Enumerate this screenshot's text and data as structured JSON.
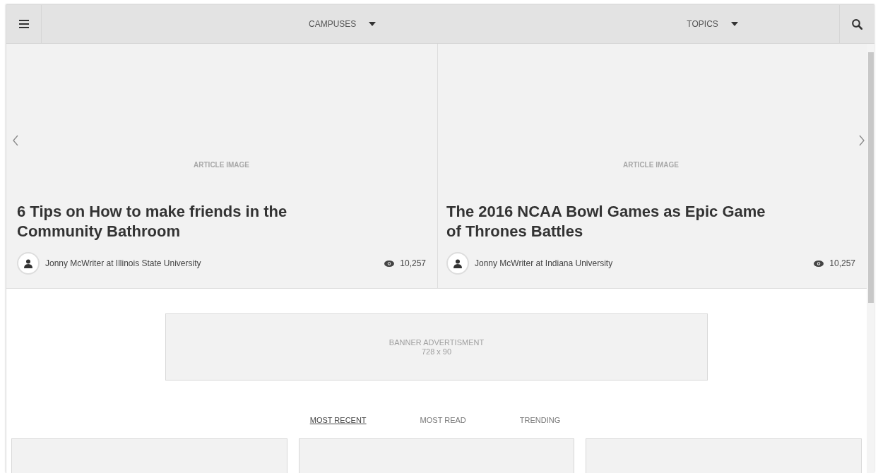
{
  "nav": {
    "dropdowns": [
      {
        "label": "CAMPUSES"
      },
      {
        "label": "TOPICS"
      }
    ]
  },
  "slides": [
    {
      "image_label": "ARTICLE IMAGE",
      "title": "6 Tips on How to make friends in the Community Bathroom",
      "author": "Jonny McWriter at Illinois State University",
      "views": "10,257"
    },
    {
      "image_label": "ARTICLE IMAGE",
      "title": "The 2016 NCAA Bowl Games as Epic Game of Thrones Battles",
      "author": "Jonny McWriter at Indiana University",
      "views": "10,257"
    }
  ],
  "banner": {
    "lines": [
      "BANNER ADVERTISMENT",
      "728 x 90"
    ]
  },
  "tabs": [
    {
      "label": "MOST RECENT",
      "selected": true
    },
    {
      "label": "MOST READ",
      "selected": false
    },
    {
      "label": "TRENDING",
      "selected": false
    }
  ],
  "cards": [
    {
      "kind": "placeholder"
    },
    {
      "kind": "placeholder"
    },
    {
      "kind": "placeholder"
    }
  ]
}
